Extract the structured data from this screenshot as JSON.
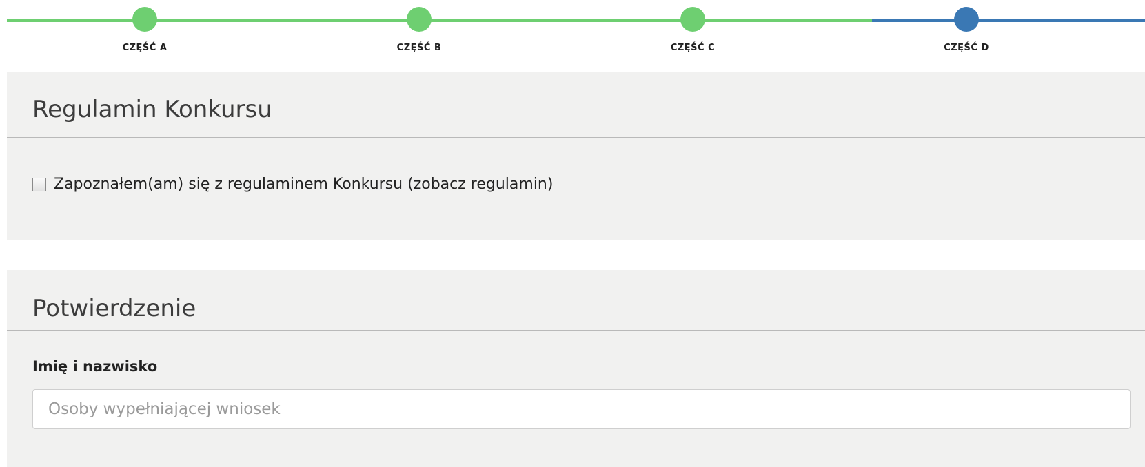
{
  "stepper": {
    "steps": [
      {
        "label": "CZĘŚĆ A",
        "state": "done"
      },
      {
        "label": "CZĘŚĆ B",
        "state": "done"
      },
      {
        "label": "CZĘŚĆ C",
        "state": "done"
      },
      {
        "label": "CZĘŚĆ D",
        "state": "active"
      }
    ],
    "colors": {
      "done": "#6ecf71",
      "active": "#3a78b4"
    }
  },
  "rules_section": {
    "title": "Regulamin Konkursu",
    "checkbox_label": "Zapoznałem(am) się z regulaminem Konkursu (zobacz regulamin)",
    "checked": false
  },
  "confirmation_section": {
    "title": "Potwierdzenie",
    "name_field": {
      "label": "Imię i nazwisko",
      "value": "",
      "placeholder": "Osoby wypełniającej wniosek"
    }
  }
}
